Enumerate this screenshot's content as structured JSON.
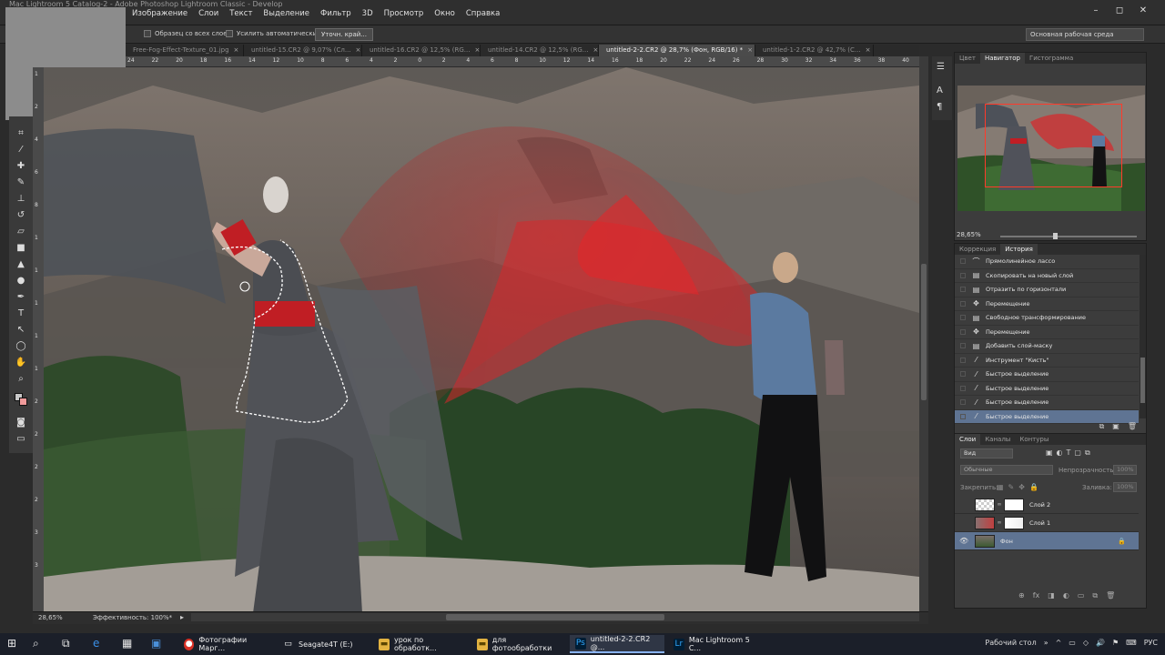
{
  "window": {
    "title": "Mac Lightroom 5 Catalog-2 - Adobe Photoshop Lightroom Classic - Develop",
    "controls": [
      "–",
      "◻",
      "✕"
    ]
  },
  "menu": [
    "Изображение",
    "Слои",
    "Текст",
    "Выделение",
    "Фильтр",
    "3D",
    "Просмотр",
    "Окно",
    "Справка"
  ],
  "options": {
    "sample_all": "Образец со всех слоев",
    "auto_enhance": "Усилить автоматически",
    "refine_edge": "Уточн. край...",
    "workspace": "Основная рабочая среда"
  },
  "tabs": [
    {
      "label": "Free-Fog-Effect-Texture_01.jpg",
      "close": "×"
    },
    {
      "label": "untitled-15.CR2 @ 9,07% (Сл...",
      "close": "×"
    },
    {
      "label": "untitled-16.CR2 @ 12,5% (RG...",
      "close": "×"
    },
    {
      "label": "untitled-14.CR2 @ 12,5% (RG...",
      "close": "×"
    },
    {
      "label": "untitled-2-2.CR2 @ 28,7% (Фон, RGB/16) *",
      "close": "×"
    },
    {
      "label": "untitled-1-2.CR2 @ 42,7% (С...",
      "close": "×"
    }
  ],
  "ruler_top": [
    "24",
    "22",
    "20",
    "18",
    "16",
    "14",
    "12",
    "10",
    "8",
    "6",
    "4",
    "2",
    "0",
    "2",
    "4",
    "6",
    "8",
    "10",
    "12",
    "14",
    "16",
    "18",
    "20",
    "22",
    "24",
    "26",
    "28",
    "30",
    "32",
    "34",
    "36",
    "38",
    "40"
  ],
  "ruler_left": [
    "1",
    "2",
    "4",
    "6",
    "8",
    "1",
    "1",
    "1",
    "1",
    "1",
    "2",
    "2",
    "2",
    "2",
    "3",
    "3"
  ],
  "status": {
    "zoom": "28,65%",
    "efficiency": "Эффективность: 100%*"
  },
  "navigator": {
    "tabs": [
      "Цвет",
      "Навигатор",
      "Гистограмма"
    ],
    "zoom": "28,65%"
  },
  "history": {
    "tabs": [
      "Коррекция",
      "История"
    ],
    "items": [
      {
        "label": "Прямолинейное лассо",
        "icon": "lasso-icon"
      },
      {
        "label": "Скопировать на новый слой",
        "icon": "doc-icon"
      },
      {
        "label": "Отразить по горизонтали",
        "icon": "doc-icon"
      },
      {
        "label": "Перемещение",
        "icon": "move-icon"
      },
      {
        "label": "Свободное трансформирование",
        "icon": "doc-icon"
      },
      {
        "label": "Перемещение",
        "icon": "move-icon"
      },
      {
        "label": "Добавить слой-маску",
        "icon": "doc-icon"
      },
      {
        "label": "Инструмент \"Кисть\"",
        "icon": "brush-icon"
      },
      {
        "label": "Быстрое выделение",
        "icon": "brush-icon"
      },
      {
        "label": "Быстрое выделение",
        "icon": "brush-icon"
      },
      {
        "label": "Быстрое выделение",
        "icon": "brush-icon"
      },
      {
        "label": "Быстрое выделение",
        "icon": "brush-icon"
      }
    ],
    "selected_index": 11
  },
  "layers": {
    "tabs": [
      "Слои",
      "Каналы",
      "Контуры"
    ],
    "filter": "Вид",
    "blend": "Обычные",
    "opacity_label": "Непрозрачность:",
    "opacity_value": "100%",
    "lock_label": "Закрепить:",
    "fill_label": "Заливка:",
    "fill_value": "100%",
    "items": [
      {
        "name": "Слой 2",
        "visible": false
      },
      {
        "name": "Слой 1",
        "visible": false
      },
      {
        "name": "Фон",
        "visible": true
      }
    ],
    "eye": "👁",
    "lock": "🔒"
  },
  "taskbar": {
    "apps": [
      {
        "label": "Фотографии Марг..."
      },
      {
        "label": "Seagate4T (E:)"
      },
      {
        "label": "урок по обработк..."
      },
      {
        "label": "для фотообработки"
      },
      {
        "label": "untitled-2-2.CR2 @..."
      },
      {
        "label": "Mac Lightroom 5 C..."
      }
    ],
    "desktop": "Рабочий стол",
    "lang": "РУС"
  }
}
